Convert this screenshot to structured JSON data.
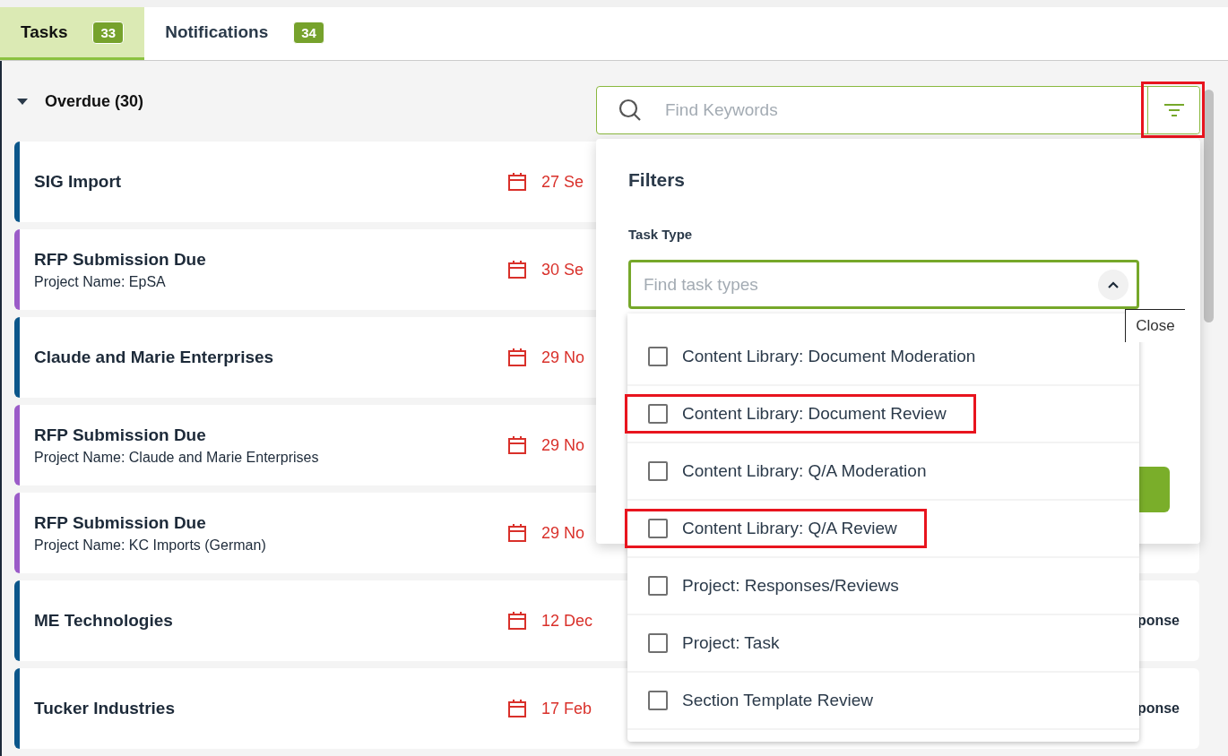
{
  "tabs": [
    {
      "label": "Tasks",
      "count": "33",
      "selected": true
    },
    {
      "label": "Notifications",
      "count": "34",
      "selected": false
    }
  ],
  "section": {
    "title": "Overdue (30)",
    "expanded": true
  },
  "tasks": [
    {
      "title": "SIG Import",
      "date": "27 Se",
      "color": "#0b568a"
    },
    {
      "title": "RFP Submission Due",
      "subtitle": "Project Name: EpSA",
      "date": "30 Se",
      "color": "#9b5bc8"
    },
    {
      "title": "Claude and Marie Enterprises",
      "date": "29 No",
      "color": "#0b568a"
    },
    {
      "title": "RFP Submission Due",
      "subtitle": "Project Name: Claude and Marie Enterprises",
      "date": "29 No",
      "color": "#9b5bc8"
    },
    {
      "title": "RFP Submission Due",
      "subtitle": "Project Name: KC Imports (German)",
      "date": "29 No",
      "color": "#9b5bc8"
    },
    {
      "title": "ME Technologies",
      "date": "12 Dec",
      "tail": "ponse",
      "color": "#0b568a"
    },
    {
      "title": "Tucker Industries",
      "date": "17 Feb",
      "tail": "ponse",
      "color": "#0b568a"
    }
  ],
  "search": {
    "placeholder": "Find Keywords",
    "filter_highlighted": true
  },
  "filters": {
    "title": "Filters",
    "label": "Task Type",
    "placeholder": "Find task types",
    "expanded": true,
    "tooltip": "Close",
    "options": [
      {
        "label": "Content Library: Document Moderation",
        "checked": false,
        "highlighted": false
      },
      {
        "label": "Content Library: Document Review",
        "checked": false,
        "highlighted": true
      },
      {
        "label": "Content Library: Q/A Moderation",
        "checked": false,
        "highlighted": false
      },
      {
        "label": "Content Library: Q/A Review",
        "checked": false,
        "highlighted": true
      },
      {
        "label": "Project: Responses/Reviews",
        "checked": false,
        "highlighted": false
      },
      {
        "label": "Project: Task",
        "checked": false,
        "highlighted": false
      },
      {
        "label": "Section Template Review",
        "checked": false,
        "highlighted": false
      }
    ]
  }
}
